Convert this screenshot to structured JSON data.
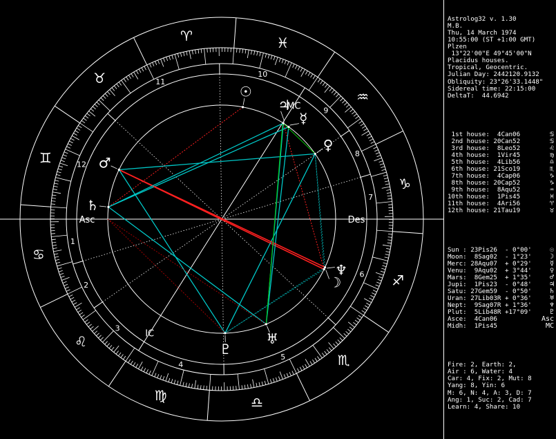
{
  "header": [
    "Astrolog32 v. 1.30",
    "M.B.",
    "Thu, 14 March 1974",
    "10:55:00 (ST +1:00 GMT)",
    "Plzen",
    " 13°22'00\"E 49°45'00\"N",
    "Placidus houses.",
    "Tropical, Geocentric.",
    "Julian Day: 2442120.9132",
    "Obliquity: 23°26'33.1448\"",
    "Sidereal time: 22:15:00",
    "DeltaT:  44.6942"
  ],
  "houses": [
    {
      "text": " 1st house:  4Can06",
      "glyph": "♋"
    },
    {
      "text": " 2nd house: 20Can52",
      "glyph": "♋"
    },
    {
      "text": " 3rd house:  8Leo52",
      "glyph": "♌"
    },
    {
      "text": " 4th house:  1Vir45",
      "glyph": "♍"
    },
    {
      "text": " 5th house:  4Lib56",
      "glyph": "♎"
    },
    {
      "text": " 6th house: 21Sco19",
      "glyph": "♏"
    },
    {
      "text": " 7th house:  4Cap06",
      "glyph": "♑"
    },
    {
      "text": " 8th house: 20Cap52",
      "glyph": "♑"
    },
    {
      "text": " 9th house:  8Aqu52",
      "glyph": "♒"
    },
    {
      "text": "10th house:  1Pis45",
      "glyph": "♓"
    },
    {
      "text": "11th house:  4Ari56",
      "glyph": "♈"
    },
    {
      "text": "12th house: 21Tau19",
      "glyph": "♉"
    }
  ],
  "planets": [
    {
      "text": "Sun : 23Pis26  - 0°00'",
      "glyph": "☉"
    },
    {
      "text": "Moon:  8Sag02  - 1°23'",
      "glyph": "☽"
    },
    {
      "text": "Merc: 28Aqu07  + 0°29'",
      "glyph": "☿"
    },
    {
      "text": "Venu:  9Aqu02  + 3°44'",
      "glyph": "♀"
    },
    {
      "text": "Mars:  8Gem25  + 1°35'",
      "glyph": "♂"
    },
    {
      "text": "Jupi:  1Pis23  - 0°48'",
      "glyph": "♃"
    },
    {
      "text": "Satu: 27Gem59  - 0°50'",
      "glyph": "♄"
    },
    {
      "text": "Uran: 27Lib03R + 0°36'",
      "glyph": "♅"
    },
    {
      "text": "Nept:  9Sag07R + 1°36'",
      "glyph": "♆"
    },
    {
      "text": "Plut:  5Lib48R +17°09'",
      "glyph": "♇"
    },
    {
      "text": "Asce:  4Can06",
      "glyph": "Asc"
    },
    {
      "text": "Midh:  1Pis45",
      "glyph": "MC"
    }
  ],
  "summary": [
    "Fire: 2, Earth: 2,",
    "Air : 6, Water: 4",
    "Car: 4, Fix: 2, Mut: 8",
    "Yang: 8, Yin: 6",
    "M: 6, N: 4, A: 3, D: 7",
    "Ang: 1, Suc: 2, Cad: 7",
    "Learn: 4, Share: 10"
  ],
  "chart_labels": {
    "asc": "Asc",
    "des": "Des",
    "mc": "MC",
    "ic": "IC",
    "house_numbers": [
      "1",
      "2",
      "3",
      "4",
      "5",
      "6",
      "7",
      "8",
      "9",
      "10",
      "11",
      "12"
    ]
  },
  "signs": [
    {
      "name": "aries-icon",
      "glyph": "♈",
      "lon": 15
    },
    {
      "name": "taurus-icon",
      "glyph": "♉",
      "lon": 45
    },
    {
      "name": "gemini-icon",
      "glyph": "♊",
      "lon": 75
    },
    {
      "name": "cancer-icon",
      "glyph": "♋",
      "lon": 105
    },
    {
      "name": "leo-icon",
      "glyph": "♌",
      "lon": 135
    },
    {
      "name": "virgo-icon",
      "glyph": "♍",
      "lon": 165
    },
    {
      "name": "libra-icon",
      "glyph": "♎",
      "lon": 195
    },
    {
      "name": "scorpio-icon",
      "glyph": "♏",
      "lon": 225
    },
    {
      "name": "sagittarius-icon",
      "glyph": "♐",
      "lon": 255
    },
    {
      "name": "capricorn-icon",
      "glyph": "♑",
      "lon": 285
    },
    {
      "name": "aquarius-icon",
      "glyph": "♒",
      "lon": 315
    },
    {
      "name": "pisces-icon",
      "glyph": "♓",
      "lon": 345
    }
  ],
  "chart_planets": [
    {
      "name": "sun-icon",
      "glyph": "☉",
      "lon": 353.43
    },
    {
      "name": "moon-icon",
      "glyph": "☽",
      "lon": 248.03
    },
    {
      "name": "mercury-icon",
      "glyph": "☿",
      "lon": 328.12
    },
    {
      "name": "venus-icon",
      "glyph": "♀",
      "lon": 309.03
    },
    {
      "name": "mars-icon",
      "glyph": "♂",
      "lon": 68.42
    },
    {
      "name": "jupiter-icon",
      "glyph": "♃",
      "lon": 331.38
    },
    {
      "name": "saturn-icon",
      "glyph": "♄",
      "lon": 87.98
    },
    {
      "name": "uranus-icon",
      "glyph": "♅",
      "lon": 207.05
    },
    {
      "name": "neptune-icon",
      "glyph": "♆",
      "lon": 249.12
    },
    {
      "name": "pluto-icon",
      "glyph": "♇",
      "lon": 185.8
    }
  ],
  "houses_lon": [
    94.1,
    110.87,
    128.87,
    151.75,
    184.93,
    231.32,
    274.1,
    290.87,
    308.87,
    331.75,
    4.93,
    51.32
  ],
  "colors": {
    "bg": "#000000",
    "fg": "#ffffff",
    "trine": "#00c8c8",
    "square": "#ff2020",
    "sextile": "#00a0a0",
    "green": "#00c000",
    "dim_red": "#a00000"
  }
}
